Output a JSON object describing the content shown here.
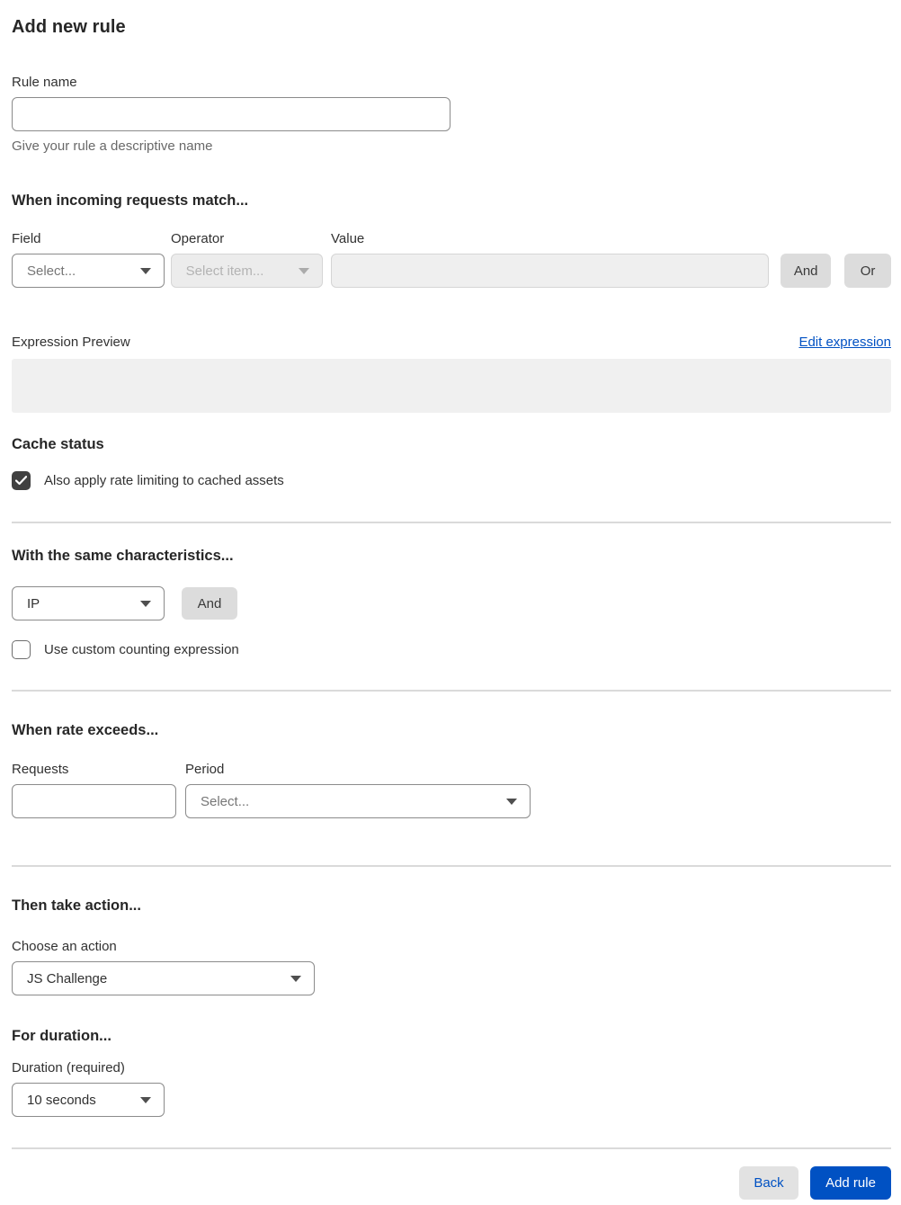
{
  "page": {
    "title": "Add new rule"
  },
  "rule_name": {
    "label": "Rule name",
    "value": "",
    "placeholder": "",
    "helper": "Give your rule a descriptive name"
  },
  "match_section": {
    "heading": "When incoming requests match...",
    "field": {
      "label": "Field",
      "selected": "Select..."
    },
    "operator": {
      "label": "Operator",
      "selected": "Select item...",
      "disabled": true
    },
    "value": {
      "label": "Value",
      "value": "",
      "disabled": true
    },
    "and_button": "And",
    "or_button": "Or",
    "expression_preview_label": "Expression Preview",
    "edit_expression_link": "Edit expression",
    "expression_preview_value": ""
  },
  "cache_status": {
    "heading": "Cache status",
    "checkbox_label": "Also apply rate limiting to cached assets",
    "checked": true
  },
  "characteristics": {
    "heading": "With the same characteristics...",
    "select": {
      "selected": "IP"
    },
    "and_button": "And",
    "checkbox_label": "Use custom counting expression",
    "checked": false
  },
  "rate": {
    "heading": "When rate exceeds...",
    "requests": {
      "label": "Requests",
      "value": ""
    },
    "period": {
      "label": "Period",
      "selected": "Select..."
    }
  },
  "action": {
    "heading": "Then take action...",
    "label": "Choose an action",
    "selected": "JS Challenge"
  },
  "duration": {
    "heading": "For duration...",
    "label": "Duration (required)",
    "selected": "10 seconds"
  },
  "footer": {
    "back_button": "Back",
    "add_rule_button": "Add rule"
  },
  "colors": {
    "accent_blue": "#0051c3",
    "link_blue": "#0051c3",
    "checkbox_checked": "#404040",
    "disabled_bg": "#ececec",
    "preview_bg": "#f0f0f0",
    "divider": "#dadada"
  }
}
